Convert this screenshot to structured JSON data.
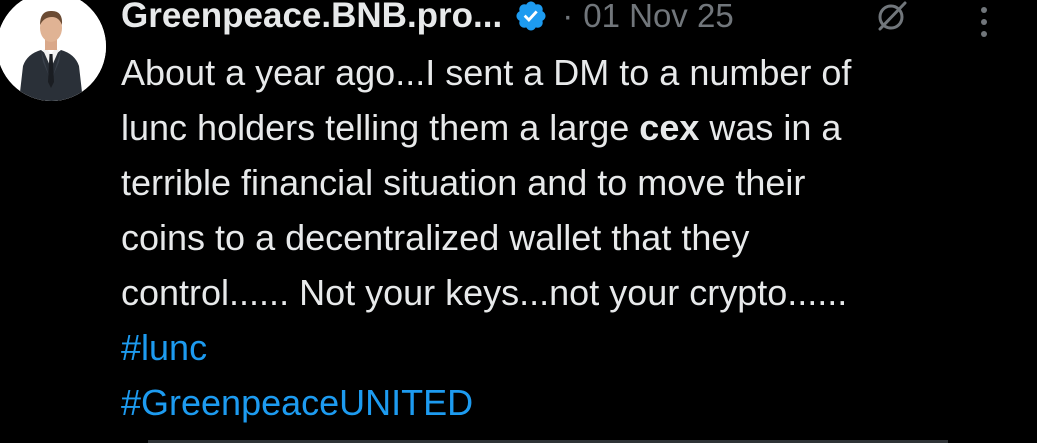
{
  "post": {
    "display_name": "Greenpeace.BNB.pro...",
    "separator": "·",
    "timestamp": "01 Nov 25",
    "verified": true,
    "text_lines": {
      "l1": "About a year ago...I sent a DM to a number of",
      "l2_before": "lunc holders telling them a large ",
      "l2_bold": "cex",
      "l2_after": " was in a",
      "l3": "terrible financial situation and to move their",
      "l4": "coins to a decentralized wallet that they",
      "l5": "control...... Not your keys...not your crypto......"
    },
    "hashtags": [
      "#lunc",
      "#GreenpeaceUNITED"
    ]
  },
  "icons": {
    "avatar": "avatar-man-in-suit",
    "verified": "verified-badge-icon",
    "grok": "grok-icon",
    "more": "more-vertical-icon"
  },
  "colors": {
    "background": "#000000",
    "text_primary": "#e7e9ea",
    "text_secondary": "#71767b",
    "link": "#1d9bf0",
    "verified": "#1d9bf0"
  }
}
